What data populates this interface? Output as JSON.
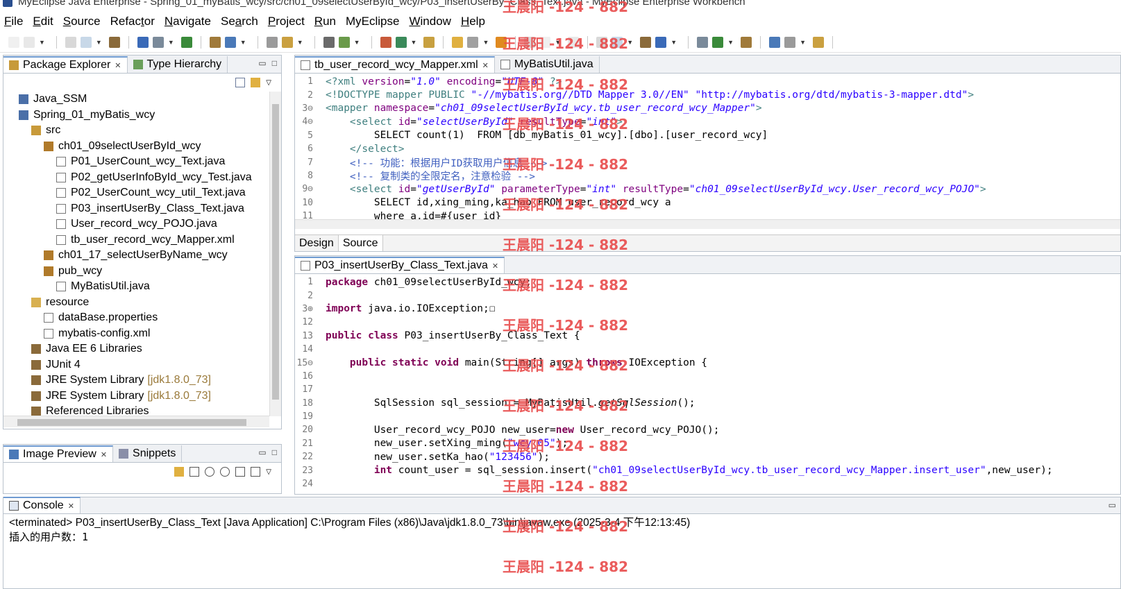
{
  "window": {
    "title": "MyEclipse Java Enterprise - Spring_01_myBatis_wcy/src/ch01_09selectUserById_wcy/P03_insertUserBy_Class_Text.java - MyEclipse Enterprise Workbench"
  },
  "menu": [
    {
      "mn": "F",
      "rest": "ile"
    },
    {
      "mn": "E",
      "rest": "dit"
    },
    {
      "mn": "S",
      "rest": "ource"
    },
    {
      "pre": "Refac",
      "mn": "t",
      "rest": "or"
    },
    {
      "mn": "N",
      "rest": "avigate"
    },
    {
      "pre": "Se",
      "mn": "a",
      "rest": "rch"
    },
    {
      "mn": "P",
      "rest": "roject"
    },
    {
      "mn": "R",
      "rest": "un"
    },
    {
      "pre": "MyEclipse",
      "mn": "",
      "rest": ""
    },
    {
      "mn": "W",
      "rest": "indow"
    },
    {
      "mn": "H",
      "rest": "elp"
    }
  ],
  "left_panel": {
    "tabs": [
      "Package Explorer",
      "Type Hierarchy"
    ],
    "tree": [
      {
        "indent": 0,
        "icon": "java-project-icon",
        "label": "Java_SSM",
        "dec": ""
      },
      {
        "indent": 0,
        "icon": "java-project-icon",
        "label": "Spring_01_myBatis_wcy",
        "dec": ""
      },
      {
        "indent": 1,
        "icon": "source-folder-icon",
        "label": "src",
        "dec": ""
      },
      {
        "indent": 2,
        "icon": "package-icon",
        "label": "ch01_09selectUserById_wcy",
        "dec": ""
      },
      {
        "indent": 3,
        "icon": "java-file-icon",
        "label": "P01_UserCount_wcy_Text.java",
        "dec": ""
      },
      {
        "indent": 3,
        "icon": "java-file-icon",
        "label": "P02_getUserInfoById_wcy_Test.java",
        "dec": ""
      },
      {
        "indent": 3,
        "icon": "java-file-icon",
        "label": "P02_UserCount_wcy_util_Text.java",
        "dec": ""
      },
      {
        "indent": 3,
        "icon": "java-file-icon",
        "label": "P03_insertUserBy_Class_Text.java",
        "dec": ""
      },
      {
        "indent": 3,
        "icon": "java-file-icon",
        "label": "User_record_wcy_POJO.java",
        "dec": ""
      },
      {
        "indent": 3,
        "icon": "xml-file-icon",
        "label": "tb_user_record_wcy_Mapper.xml",
        "dec": ""
      },
      {
        "indent": 2,
        "icon": "package-icon",
        "label": "ch01_17_selectUserByName_wcy",
        "dec": ""
      },
      {
        "indent": 2,
        "icon": "package-icon",
        "label": "pub_wcy",
        "dec": ""
      },
      {
        "indent": 3,
        "icon": "java-file-icon",
        "label": "MyBatisUtil.java",
        "dec": ""
      },
      {
        "indent": 1,
        "icon": "folder-icon",
        "label": "resource",
        "dec": ""
      },
      {
        "indent": 2,
        "icon": "properties-file-icon",
        "label": "dataBase.properties",
        "dec": ""
      },
      {
        "indent": 2,
        "icon": "xml-file-icon",
        "label": "mybatis-config.xml",
        "dec": ""
      },
      {
        "indent": 1,
        "icon": "library-icon",
        "label": "Java EE 6 Libraries",
        "dec": ""
      },
      {
        "indent": 1,
        "icon": "library-icon",
        "label": "JUnit 4",
        "dec": ""
      },
      {
        "indent": 1,
        "icon": "library-icon",
        "label": "JRE System Library",
        "dec": "[jdk1.8.0_73]"
      },
      {
        "indent": 1,
        "icon": "library-icon",
        "label": "JRE System Library",
        "dec": "[jdk1.8.0_73]"
      },
      {
        "indent": 1,
        "icon": "library-icon",
        "label": "Referenced Libraries",
        "dec": ""
      }
    ]
  },
  "bottom_left_panel": {
    "tabs": [
      "Image Preview",
      "Snippets"
    ]
  },
  "editor_top": {
    "tabs": [
      "tb_user_record_wcy_Mapper.xml",
      "MyBatisUtil.java"
    ],
    "lines": [
      {
        "n": "1",
        "html": "<span class=\"xtag\">&lt;?xml</span> <span class=\"xattr\">version</span>=<span class=\"xval\">\"1.0\"</span> <span class=\"xattr\">encoding</span>=<span class=\"xval\">\"UTF-8\"</span> <span class=\"xtag\">?&gt;</span>"
      },
      {
        "n": "2",
        "html": "<span class=\"xtag\">&lt;!DOCTYPE mapper PUBLIC </span><span class=\"str\">\"-//mybatis.org//DTD Mapper 3.0//EN\" \"http://mybatis.org/dtd/mybatis-3-mapper.dtd\"</span><span class=\"xtag\">&gt;</span>"
      },
      {
        "n": "3⊖",
        "html": "<span class=\"xtag\">&lt;mapper</span> <span class=\"xattr\">namespace</span>=<span class=\"xval\">\"ch01_09selectUserById_wcy.tb_user_record_wcy_Mapper\"</span><span class=\"xtag\">&gt;</span>"
      },
      {
        "n": "4⊖",
        "html": "    <span class=\"xtag\">&lt;select</span> <span class=\"xattr\">id</span>=<span class=\"xval\">\"selectUserById\"</span> <span class=\"xattr\">resultType</span>=<span class=\"xval\">\"int\"</span><span class=\"xtag\">&gt;</span>"
      },
      {
        "n": "5",
        "html": "        SELECT count(1)  FROM [db_myBatis_01_wcy].[dbo].[user_record_wcy]"
      },
      {
        "n": "6",
        "html": "    <span class=\"xtag\">&lt;/select&gt;</span>"
      },
      {
        "n": "7",
        "html": "    <span class=\"cmt\">&lt;!-- 功能：根据用户ID获取用户信息 --&gt;</span>"
      },
      {
        "n": "8",
        "html": "    <span class=\"cmt\">&lt;!-- 复制类的全限定名，注意检验 --&gt;</span>"
      },
      {
        "n": "9⊖",
        "html": "    <span class=\"xtag\">&lt;select</span> <span class=\"xattr\">id</span>=<span class=\"xval\">\"getUserById\"</span> <span class=\"xattr\">parameterType</span>=<span class=\"xval\">\"int\"</span> <span class=\"xattr\">resultType</span>=<span class=\"xval\">\"ch01_09selectUserById_wcy.User_record_wcy_POJO\"</span><span class=\"xtag\">&gt;</span>"
      },
      {
        "n": "10",
        "html": "        SELECT id,xing_ming,ka_hao FROM user_record_wcy a"
      },
      {
        "n": "11",
        "html": "        where a.id=#{user_id}"
      }
    ],
    "bottom_tabs": [
      "Design",
      "Source"
    ]
  },
  "editor_bottom": {
    "tabs": [
      "P03_insertUserBy_Class_Text.java"
    ],
    "lines": [
      {
        "n": "1",
        "html": "<span class=\"kw\">package</span> ch01_09selectUserById_wcy;"
      },
      {
        "n": "2",
        "html": ""
      },
      {
        "n": "3⊕",
        "html": "<span class=\"kw\">import</span> java.io.IOException;☐"
      },
      {
        "n": "12",
        "html": ""
      },
      {
        "n": "13",
        "html": "<span class=\"kw\">public</span> <span class=\"kw\">class</span> P03_insertUserBy_Class_Text {"
      },
      {
        "n": "14",
        "html": ""
      },
      {
        "n": "15⊖",
        "html": "    <span class=\"kw\">public</span> <span class=\"kw\">static</span> <span class=\"kw\">void</span> main(String[] args) <span class=\"kw\">throws</span> IOException {"
      },
      {
        "n": "16",
        "html": ""
      },
      {
        "n": "17",
        "html": ""
      },
      {
        "n": "18",
        "html": "        SqlSession sql_session = MyBatisUtil.<span class=\"ital\">getSqlSession</span>();"
      },
      {
        "n": "19",
        "html": ""
      },
      {
        "n": "20",
        "html": "        User_record_wcy_POJO new_user=<span class=\"kw\">new</span> User_record_wcy_POJO();"
      },
      {
        "n": "21",
        "html": "        new_user.setXing_ming(<span class=\"str\">\"wcy_05\"</span>);"
      },
      {
        "n": "22",
        "html": "        new_user.setKa_hao(<span class=\"str\">\"123456\"</span>);"
      },
      {
        "n": "23",
        "html": "        <span class=\"kw\">int</span> count_user = sql_session.insert(<span class=\"str\">\"ch01_09selectUserById_wcy.tb_user_record_wcy_Mapper.insert_user\"</span>,new_user);"
      },
      {
        "n": "24",
        "html": ""
      }
    ]
  },
  "console": {
    "tab": "Console",
    "status": "<terminated> P03_insertUserBy_Class_Text [Java Application] C:\\Program Files (x86)\\Java\\jdk1.8.0_73\\bin\\javaw.exe (2025-3-4 下午12:13:45)",
    "output": "插入的用户数：1"
  },
  "watermark": "王晨阳 -124 - 882",
  "colors": {
    "tab_accent": "#6f9bd1",
    "keyword": "#7f0055",
    "string": "#2a00ff",
    "watermark": "#e84b4b"
  }
}
